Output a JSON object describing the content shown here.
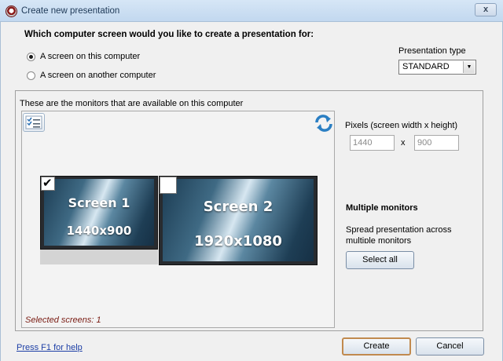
{
  "window": {
    "title": "Create new presentation",
    "close_glyph": "x"
  },
  "question": "Which computer screen would you like to create a presentation for:",
  "target_options": [
    {
      "label": "A screen on this computer",
      "selected": true
    },
    {
      "label": "A screen on another computer",
      "selected": false
    }
  ],
  "presentation_type": {
    "label": "Presentation type",
    "value": "STANDARD"
  },
  "monitors": {
    "caption": "These are the monitors that are available on this computer",
    "screens": [
      {
        "name": "Screen 1",
        "resolution": "1440x900",
        "checked": true
      },
      {
        "name": "Screen 2",
        "resolution": "1920x1080",
        "checked": false
      }
    ],
    "selected_text": "Selected screens: 1"
  },
  "pixels": {
    "label": "Pixels (screen width x height)",
    "width": "1440",
    "height": "900",
    "separator": "x"
  },
  "multiple_monitors": {
    "title": "Multiple monitors",
    "description": "Spread presentation across multiple monitors",
    "select_all_label": "Select all"
  },
  "footer": {
    "help_link": "Press F1 for help",
    "create_label": "Create",
    "cancel_label": "Cancel"
  },
  "icons": {
    "app": "presentation-app-icon",
    "checklist": "checklist-icon",
    "refresh": "refresh-icon"
  },
  "colors": {
    "title_bar": "#c7dbf0",
    "screen_face": "#3f6a84",
    "selected_text": "#7a1d14",
    "link": "#1d3fa6",
    "default_button_border": "#c18a4e"
  }
}
